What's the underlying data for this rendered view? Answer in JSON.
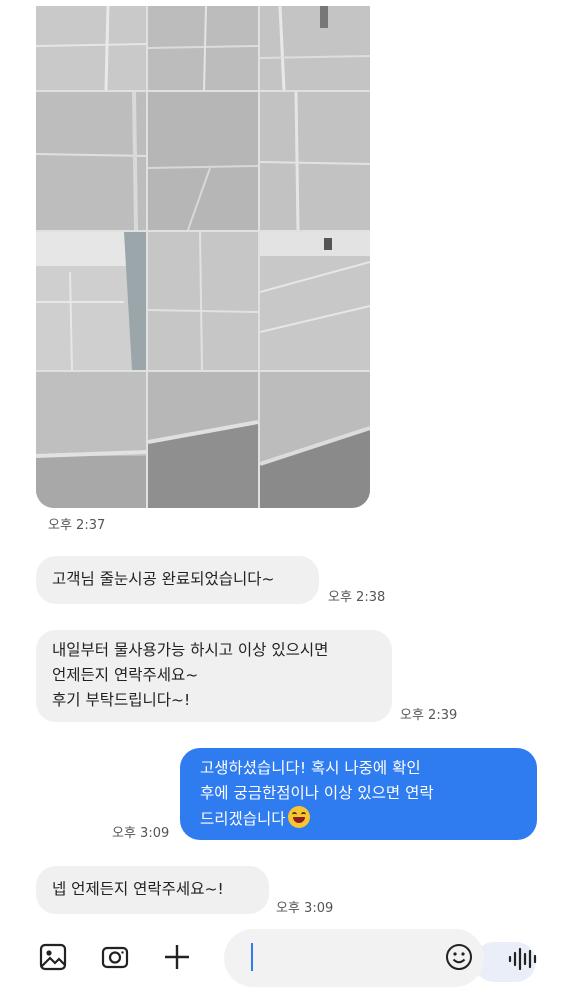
{
  "photo_message": {
    "tiles": [
      "tile-1",
      "tile-2",
      "tile-3",
      "tile-4",
      "tile-5",
      "tile-6",
      "tile-7",
      "tile-8",
      "tile-9",
      "tile-10",
      "tile-11",
      "tile-12"
    ],
    "time": "오후 2:37"
  },
  "messages": [
    {
      "direction": "in",
      "lines": [
        "고객님 줄눈시공 완료되었습니다~"
      ],
      "time": "오후 2:38"
    },
    {
      "direction": "in",
      "lines": [
        "내일부터 물사용가능 하시고 이상 있으시면",
        "언제든지 연락주세요~",
        "후기 부탁드립니다~!"
      ],
      "time": "오후 2:39"
    },
    {
      "direction": "out",
      "lines": [
        "고생하셨습니다! 혹시 나중에 확인",
        "후에 궁금한점이나 이상 있으면 연락",
        "드리겠습니다"
      ],
      "emoji": "smiling-face",
      "time": "오후 3:09"
    },
    {
      "direction": "in",
      "lines": [
        "넵 언제든지 연락주세요~!"
      ],
      "time": "오후 3:09"
    }
  ],
  "composer": {
    "icons": [
      "image-icon",
      "camera-icon",
      "plus-icon",
      "emoji-icon",
      "voice-icon"
    ],
    "text": ""
  },
  "colors": {
    "outgoing_bubble": "#2f7bf0",
    "incoming_bubble": "#f0f0f0",
    "cursor": "#2f7bf0"
  }
}
